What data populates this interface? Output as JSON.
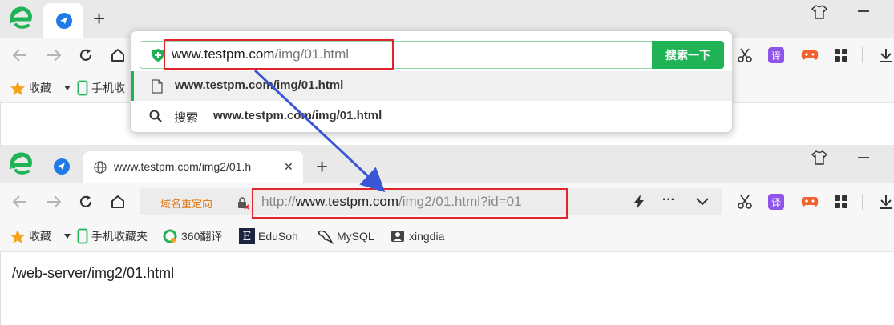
{
  "window1": {
    "new_tab_label": "+",
    "address_value_host": "www.testpm.com",
    "address_value_path": "/img/01.html",
    "search_button_label": "搜索一下",
    "suggestions": [
      {
        "icon": "page-icon",
        "text": "www.testpm.com/img/01.html"
      },
      {
        "icon": "search-icon",
        "prefix": "搜索",
        "text": "www.testpm.com/img/01.html"
      }
    ],
    "bookmark_star_label": "收藏",
    "bookmark_mobile_label": "手机收"
  },
  "window2": {
    "tab_title": "www.testpm.com/img2/01.h",
    "tab_close": "✕",
    "new_tab_label": "+",
    "redirect_label": "域名重定向",
    "url_scheme": "http://",
    "url_host": "www.testpm.com",
    "url_rest": "/img2/01.html?id=01",
    "more_label": "···",
    "bookmarks": {
      "favorites": "收藏",
      "mobile": "手机收藏夹",
      "translate": "360翻译",
      "edusoho": "EduSoh",
      "mysql": "MySQL",
      "xingdia": "xingdia"
    },
    "page_text": "/web-server/img2/01.html"
  },
  "colors": {
    "accent_green": "#1fb355",
    "highlight_red": "#e0262c",
    "arrow_blue": "#3a56d4",
    "redirect_orange": "#e07b1a"
  }
}
